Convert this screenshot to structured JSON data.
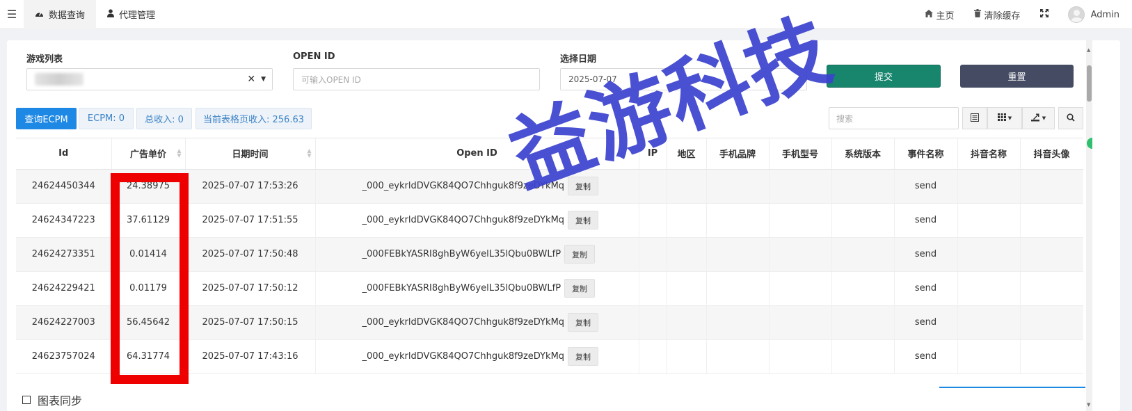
{
  "topnav": {
    "menu_icon": "hamburger-icon",
    "tabs": [
      {
        "label": "数据查询",
        "icon": "dashboard-icon",
        "active": true
      },
      {
        "label": "代理管理",
        "icon": "user-icon",
        "active": false
      }
    ],
    "right": {
      "home": "主页",
      "clear_cache": "清除缓存",
      "user": "Admin"
    }
  },
  "filters": {
    "game_label": "游戏列表",
    "openid_label": "OPEN ID",
    "openid_placeholder": "可输入OPEN ID",
    "date_label": "选择日期",
    "date_value": "2025-07-07",
    "submit": "提交",
    "reset": "重置"
  },
  "stats": {
    "query_button": "查询ECPM",
    "ecpm": "ECPM: 0",
    "total": "总收入: 0",
    "page_total": "当前表格页收入: 256.63",
    "search_placeholder": "搜索"
  },
  "table": {
    "headers": [
      "Id",
      "广告单价",
      "日期时间",
      "Open ID",
      "IP",
      "地区",
      "手机品牌",
      "手机型号",
      "系统版本",
      "事件名称",
      "抖音名称",
      "抖音头像"
    ],
    "copy_label": "复制",
    "rows": [
      {
        "id": "24624450344",
        "price": "24.38975",
        "time": "2025-07-07 17:53:26",
        "openid": "_000_eykrldDVGK84QO7Chhguk8f9zeDYkMq",
        "event": "send"
      },
      {
        "id": "24624347223",
        "price": "37.61129",
        "time": "2025-07-07 17:51:55",
        "openid": "_000_eykrldDVGK84QO7Chhguk8f9zeDYkMq",
        "event": "send"
      },
      {
        "id": "24624273351",
        "price": "0.01414",
        "time": "2025-07-07 17:50:48",
        "openid": "_000FEBkYASRI8ghByW6yelL35lQbu0BWLfP",
        "event": "send"
      },
      {
        "id": "24624229421",
        "price": "0.01179",
        "time": "2025-07-07 17:50:12",
        "openid": "_000FEBkYASRI8ghByW6yelL35lQbu0BWLfP",
        "event": "send"
      },
      {
        "id": "24624227003",
        "price": "56.45642",
        "time": "2025-07-07 17:50:15",
        "openid": "_000_eykrldDVGK84QO7Chhguk8f9zeDYkMq",
        "event": "send"
      },
      {
        "id": "24623757024",
        "price": "64.31774",
        "time": "2025-07-07 17:43:16",
        "openid": "_000_eykrldDVGK84QO7Chhguk8f9zeDYkMq",
        "event": "send"
      }
    ]
  },
  "watermark": "益游科技",
  "bottom_section_title": "图表同步",
  "colors": {
    "submit": "#18856d",
    "reset": "#444b63",
    "primary": "#1e88e5",
    "highlight": "#ee0000",
    "watermark": "#3b42cf"
  }
}
